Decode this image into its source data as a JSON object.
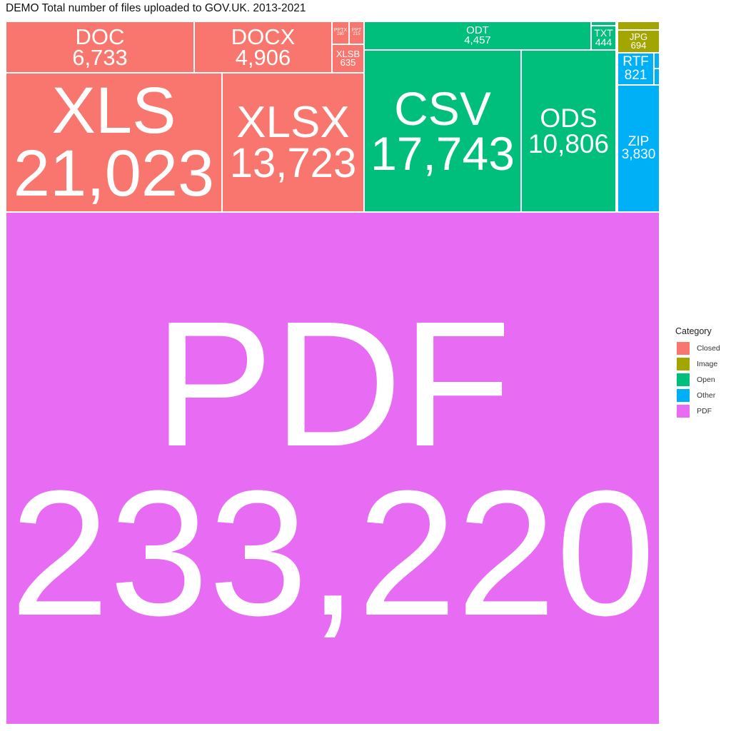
{
  "chart_data": {
    "type": "treemap",
    "title": "DEMO Total number of files uploaded to GOV.UK. 2013-2021",
    "legend": {
      "title": "Category",
      "position": "right",
      "entries": [
        {
          "name": "Closed",
          "color": "#F8766D"
        },
        {
          "name": "Image",
          "color": "#A3A500"
        },
        {
          "name": "Open",
          "color": "#00BF7D"
        },
        {
          "name": "Other",
          "color": "#00B0F6"
        },
        {
          "name": "PDF",
          "color": "#E76BF3"
        }
      ]
    },
    "items": [
      {
        "label": "PDF",
        "value": 233220,
        "value_text": "233,220",
        "category": "PDF"
      },
      {
        "label": "XLS",
        "value": 21023,
        "value_text": "21,023",
        "category": "Closed"
      },
      {
        "label": "XLSX",
        "value": 13723,
        "value_text": "13,723",
        "category": "Closed"
      },
      {
        "label": "DOC",
        "value": 6733,
        "value_text": "6,733",
        "category": "Closed"
      },
      {
        "label": "DOCX",
        "value": 4906,
        "value_text": "4,906",
        "category": "Closed"
      },
      {
        "label": "XLSB",
        "value": 635,
        "value_text": "635",
        "category": "Closed"
      },
      {
        "label": "PPTX",
        "value": 280,
        "value_text": "280",
        "category": "Closed"
      },
      {
        "label": "PPT",
        "value": 215,
        "value_text": "215",
        "category": "Closed"
      },
      {
        "label": "CSV",
        "value": 17743,
        "value_text": "17,743",
        "category": "Open"
      },
      {
        "label": "ODS",
        "value": 10806,
        "value_text": "10,806",
        "category": "Open"
      },
      {
        "label": "ODT",
        "value": 4457,
        "value_text": "4,457",
        "category": "Open"
      },
      {
        "label": "TXT",
        "value": 444,
        "value_text": "444",
        "category": "Open"
      },
      {
        "label": "",
        "value": null,
        "value_text": "",
        "category": "Open"
      },
      {
        "label": "JPG",
        "value": 694,
        "value_text": "694",
        "category": "Image"
      },
      {
        "label": "",
        "value": null,
        "value_text": "",
        "category": "Image"
      },
      {
        "label": "ZIP",
        "value": 3830,
        "value_text": "3,830",
        "category": "Other"
      },
      {
        "label": "RTF",
        "value": 821,
        "value_text": "821",
        "category": "Other"
      },
      {
        "label": "",
        "value": null,
        "value_text": "",
        "category": "Other"
      },
      {
        "label": "",
        "value": null,
        "value_text": "",
        "category": "Other"
      }
    ]
  }
}
